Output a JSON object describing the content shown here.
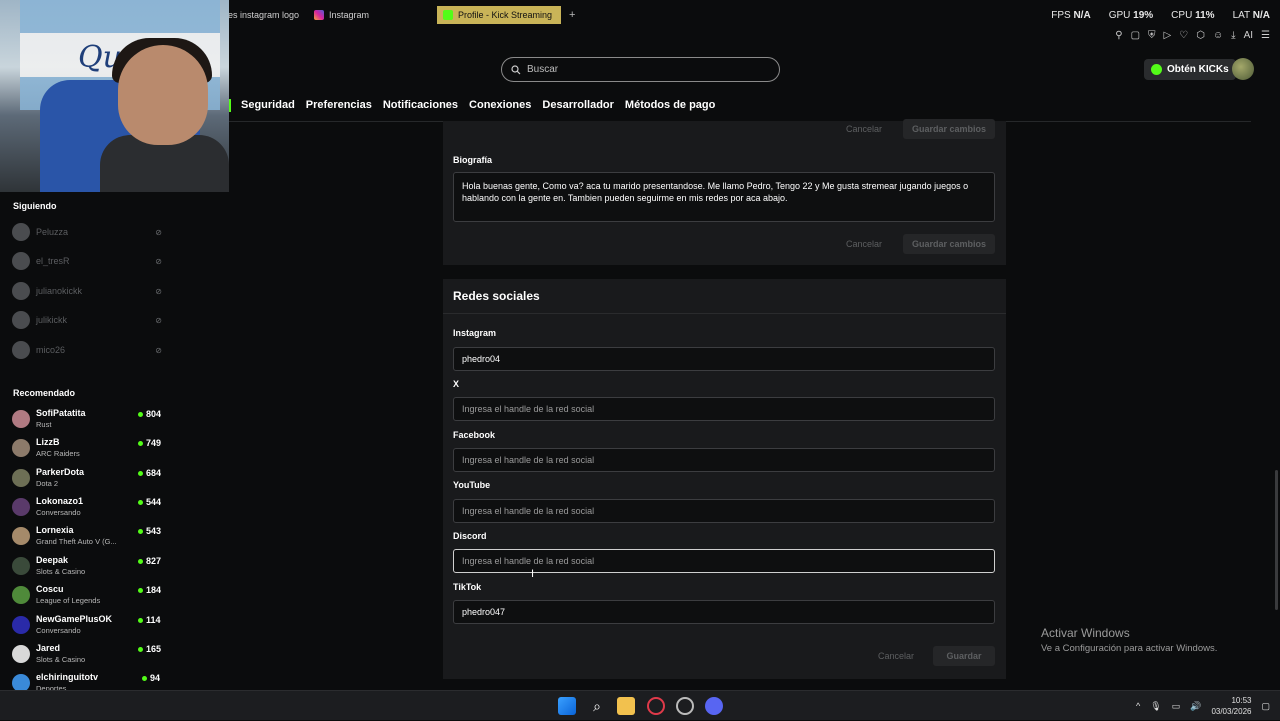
{
  "browser": {
    "tabs": [
      {
        "label": "es instagram logo"
      },
      {
        "label": "Instagram"
      },
      {
        "label": "Profile - Kick Streaming"
      }
    ],
    "new_tab": "+"
  },
  "overlay": {
    "fps_label": "FPS",
    "fps_value": "N/A",
    "gpu_label": "GPU",
    "gpu_value": "19",
    "cpu_label": "CPU",
    "cpu_value": "11",
    "lat_label": "LAT",
    "lat_value": "N/A",
    "ai_label": "AI"
  },
  "header": {
    "search_placeholder": "Buscar",
    "kicks_button": "Obtén KICKs"
  },
  "settings_nav": [
    "Seguridad",
    "Preferencias",
    "Notificaciones",
    "Conexiones",
    "Desarrollador",
    "Métodos de pago"
  ],
  "sidebar": {
    "following_heading": "Siguiendo",
    "following": [
      "Peluzza",
      "el_tresR",
      "julianokickk",
      "julikickk",
      "mico26"
    ],
    "recommended_heading": "Recomendado",
    "recommended": [
      {
        "name": "SofiPatatita",
        "category": "Rust",
        "viewers": "804"
      },
      {
        "name": "LizzB",
        "category": "ARC Raiders",
        "viewers": "749"
      },
      {
        "name": "ParkerDota",
        "category": "Dota 2",
        "viewers": "684"
      },
      {
        "name": "Lokonazo1",
        "category": "Conversando",
        "viewers": "544"
      },
      {
        "name": "Lornexia",
        "category": "Grand Theft Auto V (G...",
        "viewers": "543"
      },
      {
        "name": "Deepak",
        "category": "Slots & Casino",
        "viewers": "827"
      },
      {
        "name": "Coscu",
        "category": "League of Legends",
        "viewers": "184"
      },
      {
        "name": "NewGamePlusOK",
        "category": "Conversando",
        "viewers": "114"
      },
      {
        "name": "Jared",
        "category": "Slots & Casino",
        "viewers": "165"
      },
      {
        "name": "elchiringuitotv",
        "category": "Deportes",
        "viewers": "94"
      }
    ]
  },
  "bio_card": {
    "top_cancel": "Cancelar",
    "top_save": "Guardar cambios",
    "label": "Biografía",
    "text": "Hola buenas gente, Como va? aca tu marido presentandose. Me llamo Pedro, Tengo 22 y Me gusta stremear jugando juegos o hablando con la gente en. Tambien pueden seguirme en mis redes por aca abajo.",
    "cancel": "Cancelar",
    "save": "Guardar cambios"
  },
  "social_card": {
    "title": "Redes sociales",
    "placeholder": "Ingresa el handle de la red social",
    "fields": [
      {
        "label": "Instagram",
        "value": "phedro04"
      },
      {
        "label": "X",
        "value": ""
      },
      {
        "label": "Facebook",
        "value": ""
      },
      {
        "label": "YouTube",
        "value": ""
      },
      {
        "label": "Discord",
        "value": ""
      },
      {
        "label": "TikTok",
        "value": "phedro047"
      }
    ],
    "cancel": "Cancelar",
    "save": "Guardar"
  },
  "watermark": {
    "line1": "Activar Windows",
    "line2": "Ve a Configuración para activar Windows."
  },
  "taskbar": {
    "time": "10:53",
    "date": "03/03/2026"
  }
}
